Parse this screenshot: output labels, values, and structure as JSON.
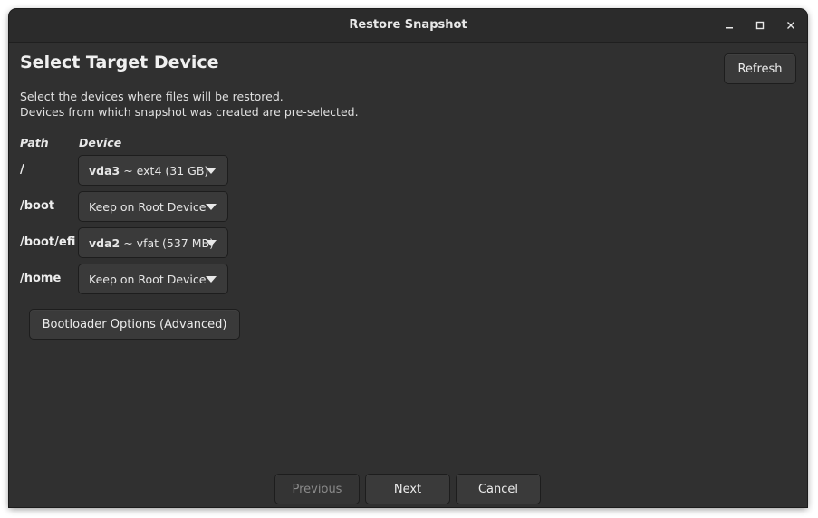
{
  "window": {
    "title": "Restore Snapshot"
  },
  "icons": {
    "minimize": "minimize-icon",
    "maximize": "maximize-icon",
    "close": "close-icon",
    "dropdown": "triangle-down-icon"
  },
  "page": {
    "heading": "Select Target Device",
    "description_line1": "Select the devices where files will be restored.",
    "description_line2": "Devices from which snapshot was created are pre-selected.",
    "refresh_label": "Refresh"
  },
  "table": {
    "headers": {
      "path": "Path",
      "device": "Device"
    },
    "rows": [
      {
        "path": "/",
        "device_name": "vda3",
        "device_detail": "~ ext4 (31 GB)"
      },
      {
        "path": "/boot",
        "device_name": "",
        "device_detail": "Keep on Root Device"
      },
      {
        "path": "/boot/efi",
        "device_name": "vda2",
        "device_detail": "~ vfat (537 MB)"
      },
      {
        "path": "/home",
        "device_name": "",
        "device_detail": "Keep on Root Device"
      }
    ]
  },
  "bootloader_label": "Bootloader Options (Advanced)",
  "footer": {
    "previous_label": "Previous",
    "next_label": "Next",
    "cancel_label": "Cancel"
  },
  "colors": {
    "window_bg": "#303030",
    "titlebar_bg": "#2b2b2b",
    "button_bg": "#3a3a3a",
    "text": "#e6e6e6",
    "disabled_text": "#8a8a8a"
  }
}
